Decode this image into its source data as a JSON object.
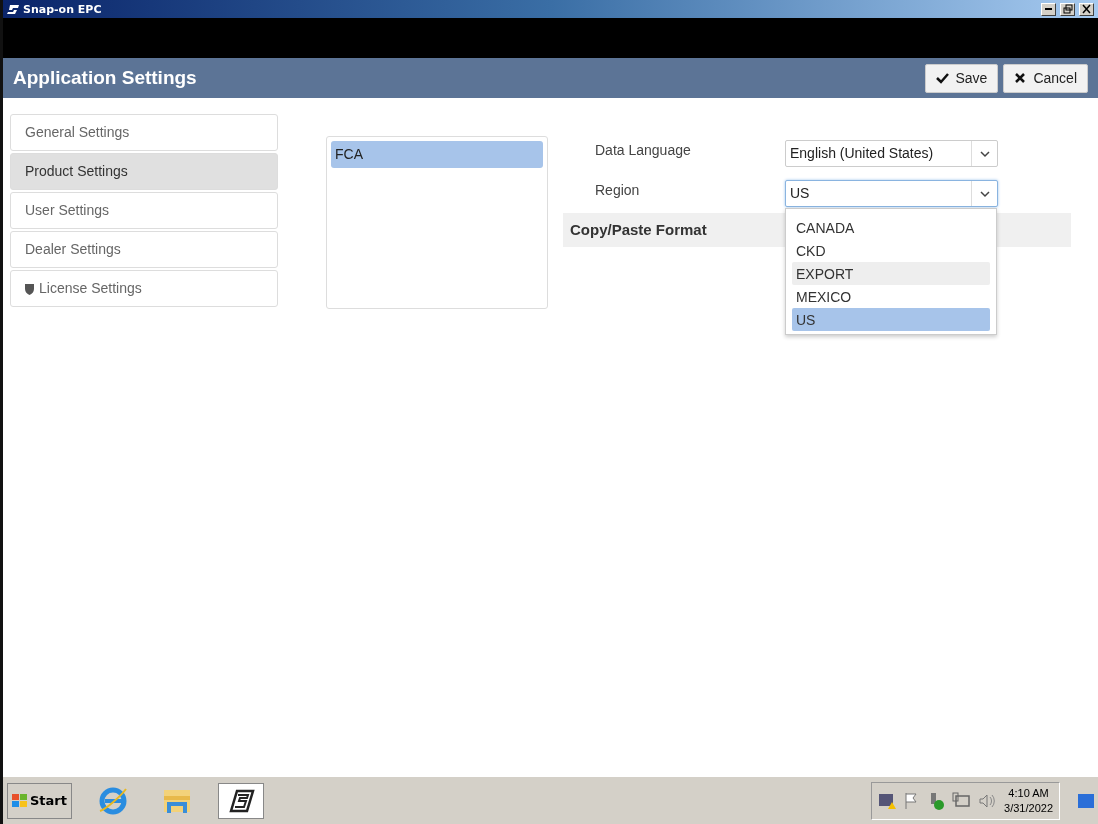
{
  "window": {
    "title": "Snap-on EPC"
  },
  "header": {
    "title": "Application Settings",
    "buttons": [
      {
        "label": "Save",
        "kind": "save"
      },
      {
        "label": "Cancel",
        "kind": "cancel"
      }
    ]
  },
  "sidebar": {
    "items": [
      {
        "label": "General Settings",
        "selected": false,
        "kind": "plain"
      },
      {
        "label": "Product Settings",
        "selected": true,
        "kind": "plain"
      },
      {
        "label": "User Settings",
        "selected": false,
        "kind": "plain"
      },
      {
        "label": "Dealer Settings",
        "selected": false,
        "kind": "plain"
      },
      {
        "label": "License Settings",
        "selected": false,
        "kind": "shield"
      }
    ]
  },
  "products": [
    {
      "label": "FCA",
      "selected": true
    }
  ],
  "fields": [
    {
      "label": "Data Language",
      "value": "English (United States)",
      "expanded": false
    },
    {
      "label": "Region",
      "value": "US",
      "expanded": true,
      "options": [
        {
          "label": "CANADA",
          "selected": false,
          "hovered": false
        },
        {
          "label": "CKD",
          "selected": false,
          "hovered": false
        },
        {
          "label": "EXPORT",
          "selected": false,
          "hovered": true
        },
        {
          "label": "MEXICO",
          "selected": false,
          "hovered": false
        },
        {
          "label": "US",
          "selected": true,
          "hovered": false
        }
      ]
    }
  ],
  "section": {
    "title": "Copy/Paste Format"
  },
  "taskbar": {
    "start": "Start",
    "apps": [
      {
        "kind": "browser",
        "selected": false
      },
      {
        "kind": "folder",
        "selected": false
      },
      {
        "kind": "epc",
        "selected": true
      }
    ],
    "time": "4:10 AM",
    "date": "3/31/2022"
  }
}
